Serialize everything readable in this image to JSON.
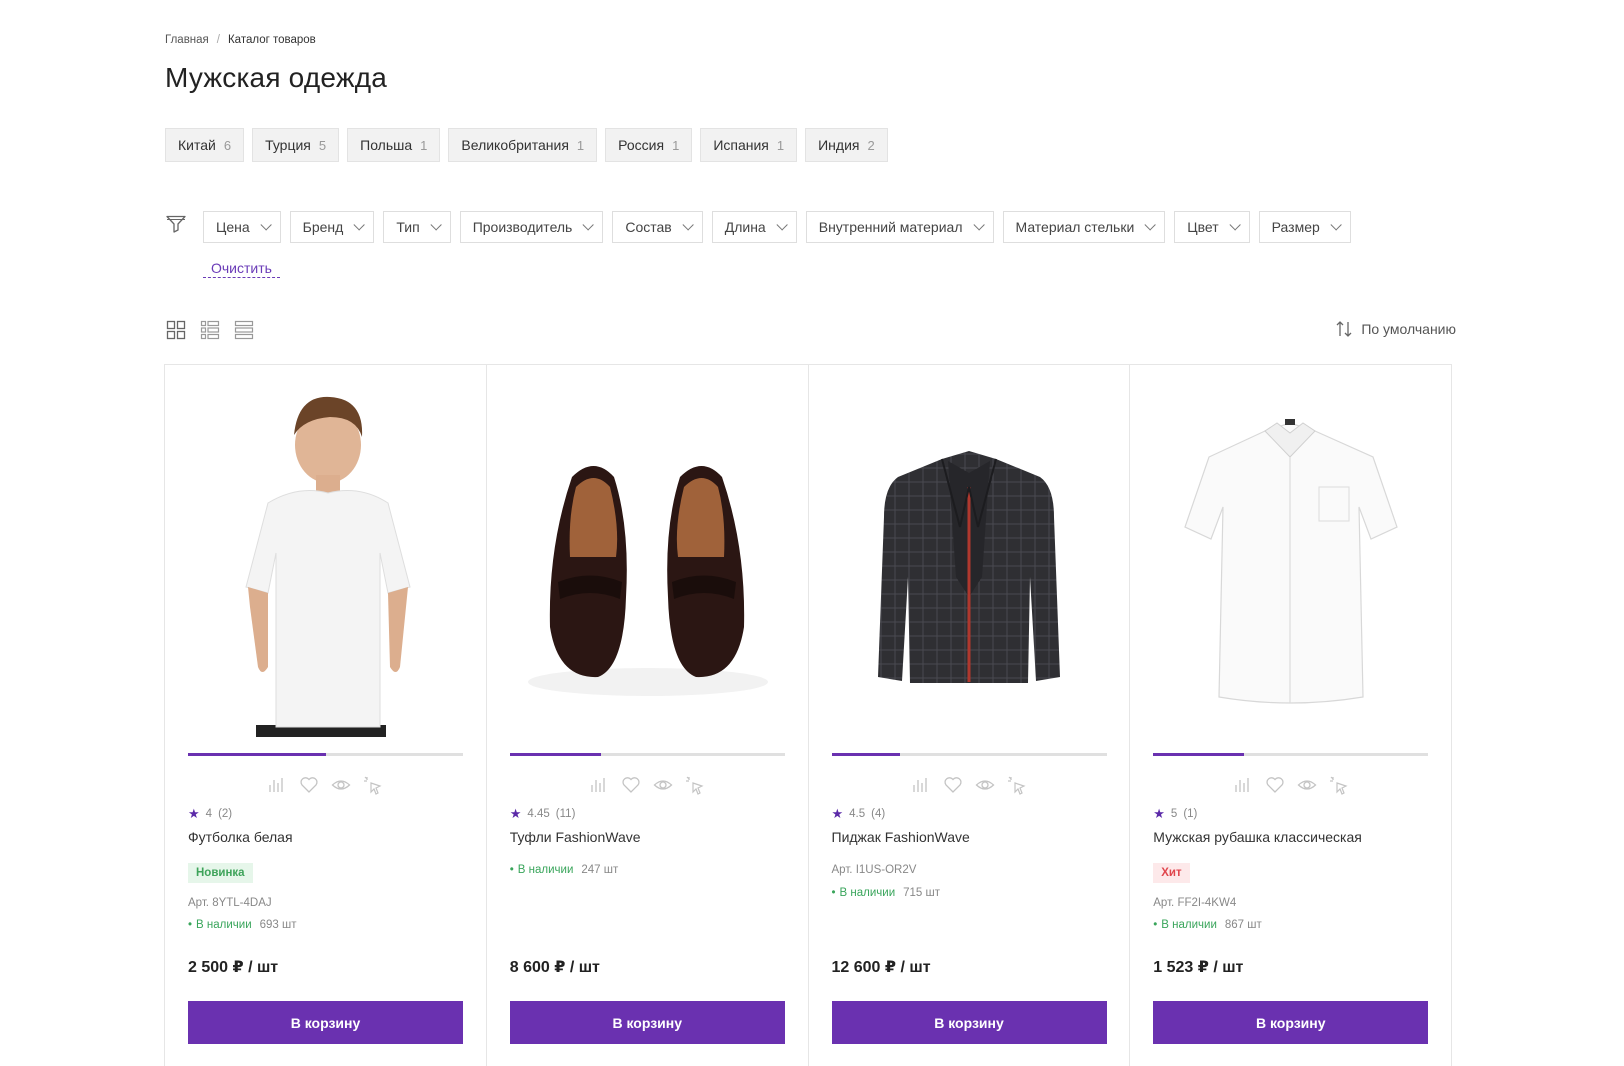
{
  "breadcrumb": {
    "home": "Главная",
    "separator": "/",
    "current": "Каталог товаров"
  },
  "page_title": "Мужская одежда",
  "countries": [
    {
      "name": "Китай",
      "count": "6"
    },
    {
      "name": "Турция",
      "count": "5"
    },
    {
      "name": "Польша",
      "count": "1"
    },
    {
      "name": "Великобритания",
      "count": "1"
    },
    {
      "name": "Россия",
      "count": "1"
    },
    {
      "name": "Испания",
      "count": "1"
    },
    {
      "name": "Индия",
      "count": "2"
    }
  ],
  "filters": [
    "Цена",
    "Бренд",
    "Тип",
    "Производитель",
    "Состав",
    "Длина",
    "Внутренний материал",
    "Материал стельки",
    "Цвет",
    "Размер"
  ],
  "clear_label": "Очистить",
  "sort_label": "По умолчанию",
  "icons": {
    "filter": "funnel-icon",
    "grid_view": "grid-view-icon",
    "list_view": "list-view-icon",
    "table_view": "table-view-icon",
    "sort": "sort-icon"
  },
  "accent_color": "#6a31b0",
  "products": [
    {
      "rating": "4",
      "reviews": "(2)",
      "name": "Футболка белая",
      "badge": "Новинка",
      "badge_type": "new",
      "article": "Арт. 8YTL-4DAJ",
      "stock_label": "В наличии",
      "stock_qty": "693 шт",
      "price": "2 500 ₽ / шт",
      "cart": "В корзину",
      "gallery_progress": 0.5
    },
    {
      "rating": "4.45",
      "reviews": "(11)",
      "name": "Туфли FashionWave",
      "badge": "",
      "badge_type": "",
      "article": "",
      "stock_label": "В наличии",
      "stock_qty": "247 шт",
      "price": "8 600 ₽ / шт",
      "cart": "В корзину",
      "gallery_progress": 0.33
    },
    {
      "rating": "4.5",
      "reviews": "(4)",
      "name": "Пиджак FashionWave",
      "badge": "",
      "badge_type": "",
      "article": "Арт. I1US-OR2V",
      "stock_label": "В наличии",
      "stock_qty": "715 шт",
      "price": "12 600 ₽ / шт",
      "cart": "В корзину",
      "gallery_progress": 0.25
    },
    {
      "rating": "5",
      "reviews": "(1)",
      "name": "Мужская рубашка классическая",
      "badge": "Хит",
      "badge_type": "hit",
      "article": "Арт. FF2I-4KW4",
      "stock_label": "В наличии",
      "stock_qty": "867 шт",
      "price": "1 523 ₽ / шт",
      "cart": "В корзину",
      "gallery_progress": 0.33
    }
  ]
}
